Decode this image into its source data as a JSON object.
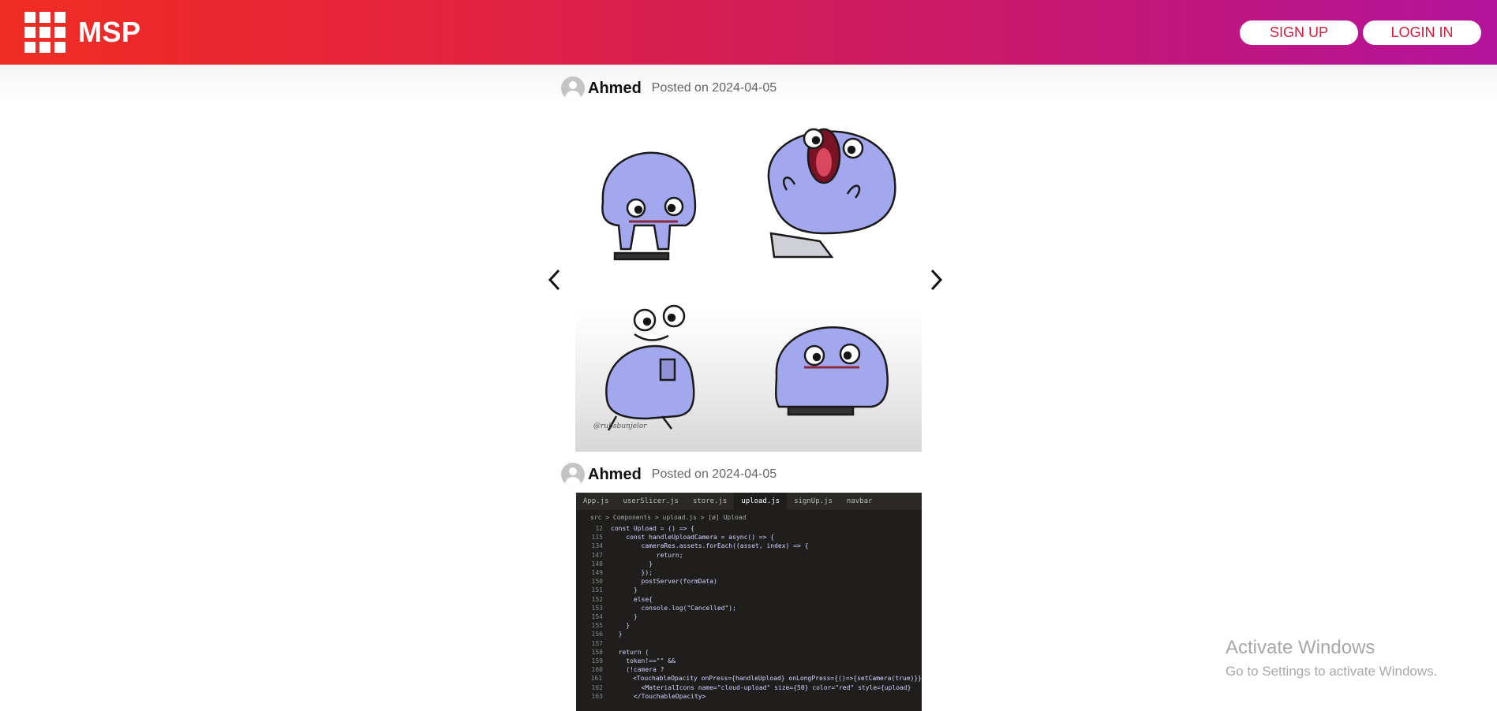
{
  "brand": {
    "name": "MSP",
    "icon": "grid-apps-icon"
  },
  "nav": {
    "signup_label": "SIGN UP",
    "login_label": "LOGIN IN"
  },
  "posts": [
    {
      "author": "Ahmed",
      "date_text": "Posted on 2024-04-05",
      "image": "cartoon-blob-scale-comic",
      "signature": "@rubsbunjelor"
    },
    {
      "author": "Ahmed",
      "date_text": "Posted on 2024-04-05",
      "image": "code-editor-photo"
    }
  ],
  "carousel": {
    "prev_icon": "chevron-left-icon",
    "next_icon": "chevron-right-icon"
  },
  "code": {
    "tabs": [
      "App.js",
      "userSlicer.js",
      "store.js",
      "upload.js",
      "signUp.js",
      "navbar"
    ],
    "breadcrumb": "src > Components > upload.js > [ø] Upload",
    "lines": [
      {
        "n": "12",
        "t": "const Upload = () => {"
      },
      {
        "n": "115",
        "t": "    const handleUploadCamera = async() => {"
      },
      {
        "n": "134",
        "t": "        cameraRes.assets.forEach((asset, index) => {"
      },
      {
        "n": "147",
        "t": "            return;"
      },
      {
        "n": "148",
        "t": "          }"
      },
      {
        "n": "149",
        "t": "        });"
      },
      {
        "n": "150",
        "t": "        postServer(formData)"
      },
      {
        "n": "151",
        "t": "      }"
      },
      {
        "n": "152",
        "t": "      else{"
      },
      {
        "n": "153",
        "t": "        console.log(\"Cancelled\");"
      },
      {
        "n": "154",
        "t": "      }"
      },
      {
        "n": "155",
        "t": "    }"
      },
      {
        "n": "156",
        "t": "  }"
      },
      {
        "n": "157",
        "t": ""
      },
      {
        "n": "158",
        "t": "  return ("
      },
      {
        "n": "159",
        "t": "    token!==\"\" &&"
      },
      {
        "n": "160",
        "t": "    (!camera ?"
      },
      {
        "n": "161",
        "t": "      <TouchableOpacity onPress={handleUpload} onLongPress={()=>{setCamera(true)}}"
      },
      {
        "n": "162",
        "t": "        <MaterialIcons name=\"cloud-upload\" size={50} color=\"red\" style={upload}"
      },
      {
        "n": "163",
        "t": "      </TouchableOpacity>"
      }
    ]
  },
  "watermark": {
    "title": "Activate Windows",
    "subtitle": "Go to Settings to activate Windows."
  }
}
